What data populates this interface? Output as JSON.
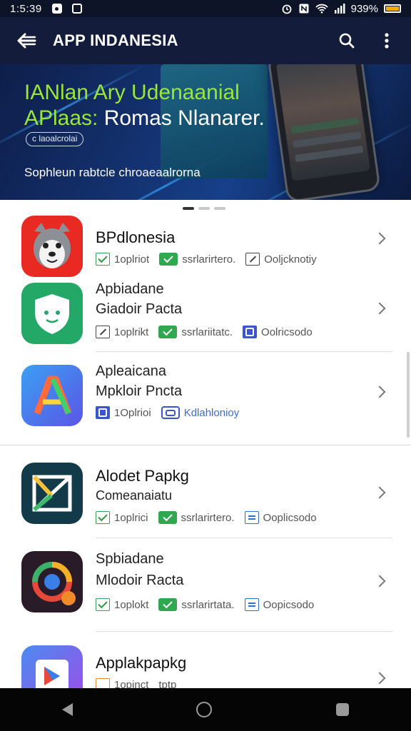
{
  "status_bar": {
    "time": "1:5:39",
    "battery": "939%"
  },
  "app_bar": {
    "title": "APP INDANESIA"
  },
  "banner": {
    "headline_line1": "IANlan Ary Udenaanial",
    "headline_line2a": "APlaas:",
    "headline_line2b": " Romas Nlanarer.",
    "chip": "c laoalcrolai",
    "subtitle": "Sophleun rabtcle chroaeaalrorna"
  },
  "apps": [
    {
      "name": "BPdlonesia",
      "name2": "",
      "meta": [
        "1oplriot",
        "ssrlarirtero.",
        "Ooljcknotiy"
      ]
    },
    {
      "name": "Apbiadane",
      "name2": "Giadoir Pacta",
      "meta": [
        "1oplrikt",
        "ssrlariitatc.",
        "Oolricsodo"
      ]
    },
    {
      "name": "Apleaicana",
      "name2": "Mpkloir Pncta",
      "meta": [
        "1Oplrioi",
        "Kdlahlonioy"
      ]
    },
    {
      "name": "Alodet Papkg",
      "name2": "Comeanaiatu",
      "meta": [
        "1oplrici",
        "ssrlarirtero.",
        "Ooplicsodo"
      ]
    },
    {
      "name": "Spbiadane",
      "name2": "Mlodoir Racta",
      "meta": [
        "1oplokt",
        "ssrlarirtata.",
        "Oopicsodo"
      ]
    },
    {
      "name": "Applakpapkg",
      "name2": "",
      "meta": [
        "1opinct",
        "tptp"
      ]
    }
  ]
}
